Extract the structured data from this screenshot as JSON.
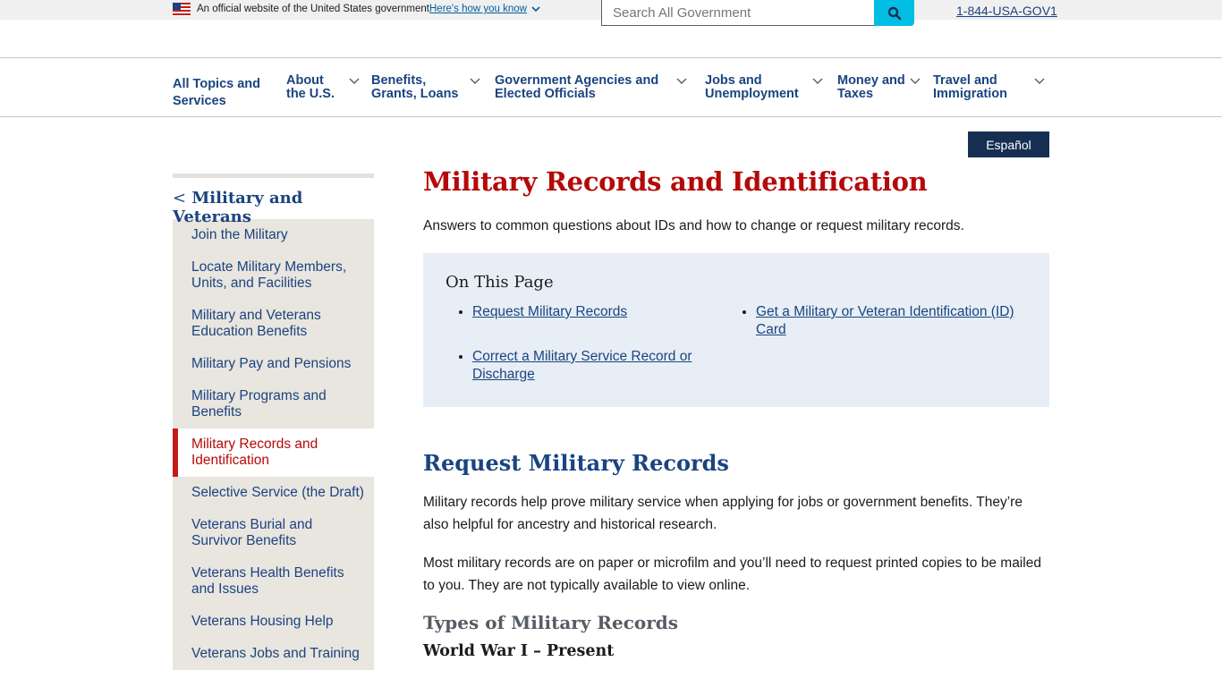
{
  "banner": {
    "official_text": "An official website of the United States government",
    "how_you_know_link": "Here's how you know",
    "flag_icon": "us-flag-icon",
    "chevron_icon": "chevron-down-icon"
  },
  "search": {
    "placeholder": "Search All Government",
    "button_icon": "search-icon",
    "button_color": "#00bde3"
  },
  "phone": "1-844-USA-GOV1",
  "nav": {
    "items": [
      {
        "label": "All Topics and Services",
        "has_dropdown": false
      },
      {
        "label": "About the U.S.",
        "has_dropdown": true
      },
      {
        "label": "Benefits, Grants, Loans",
        "has_dropdown": true
      },
      {
        "label": "Government Agencies and Elected Officials",
        "has_dropdown": true
      },
      {
        "label": "Jobs and Unemployment",
        "has_dropdown": true
      },
      {
        "label": "Money and Taxes",
        "has_dropdown": true
      },
      {
        "label": "Travel and Immigration",
        "has_dropdown": true
      }
    ]
  },
  "language_button": "Español",
  "sidebar": {
    "back_link": "Military and Veterans",
    "back_glyph": "<",
    "items": [
      {
        "label": "Join the Military",
        "active": false
      },
      {
        "label": "Locate Military Members, Units, and Facilities",
        "active": false
      },
      {
        "label": "Military and Veterans Education Benefits",
        "active": false
      },
      {
        "label": "Military Pay and Pensions",
        "active": false
      },
      {
        "label": "Military Programs and Benefits",
        "active": false
      },
      {
        "label": "Military Records and Identification",
        "active": true
      },
      {
        "label": "Selective Service (the Draft)",
        "active": false
      },
      {
        "label": "Veterans Burial and Survivor Benefits",
        "active": false
      },
      {
        "label": "Veterans Health Benefits and Issues",
        "active": false
      },
      {
        "label": "Veterans Housing Help",
        "active": false
      },
      {
        "label": "Veterans Jobs and Training",
        "active": false
      }
    ]
  },
  "main": {
    "title": "Military Records and Identification",
    "intro": "Answers to common questions about IDs and how to change or request military records.",
    "on_this_page": {
      "heading": "On This Page",
      "links": [
        "Request Military Records",
        "Correct a Military Service Record or Discharge",
        "Get a Military or Veteran Identification (ID) Card"
      ]
    },
    "section_heading": "Request Military Records",
    "paragraph_1": "Military records help prove military service when applying for jobs or government benefits. They’re also helpful for ancestry and historical research.",
    "paragraph_2": "Most military records are on paper or microfilm and you’ll need to request printed copies to be mailed to you. They are not typically available to view online.",
    "subheading": "Types of Military Records",
    "sub_subheading": "World War I – Present"
  },
  "colors": {
    "brand_navy": "#1a4480",
    "title_red": "#b50909",
    "sidebar_bg": "#e9e5df",
    "otp_bg": "#e7eef5",
    "espanol_bg": "#162e51"
  }
}
